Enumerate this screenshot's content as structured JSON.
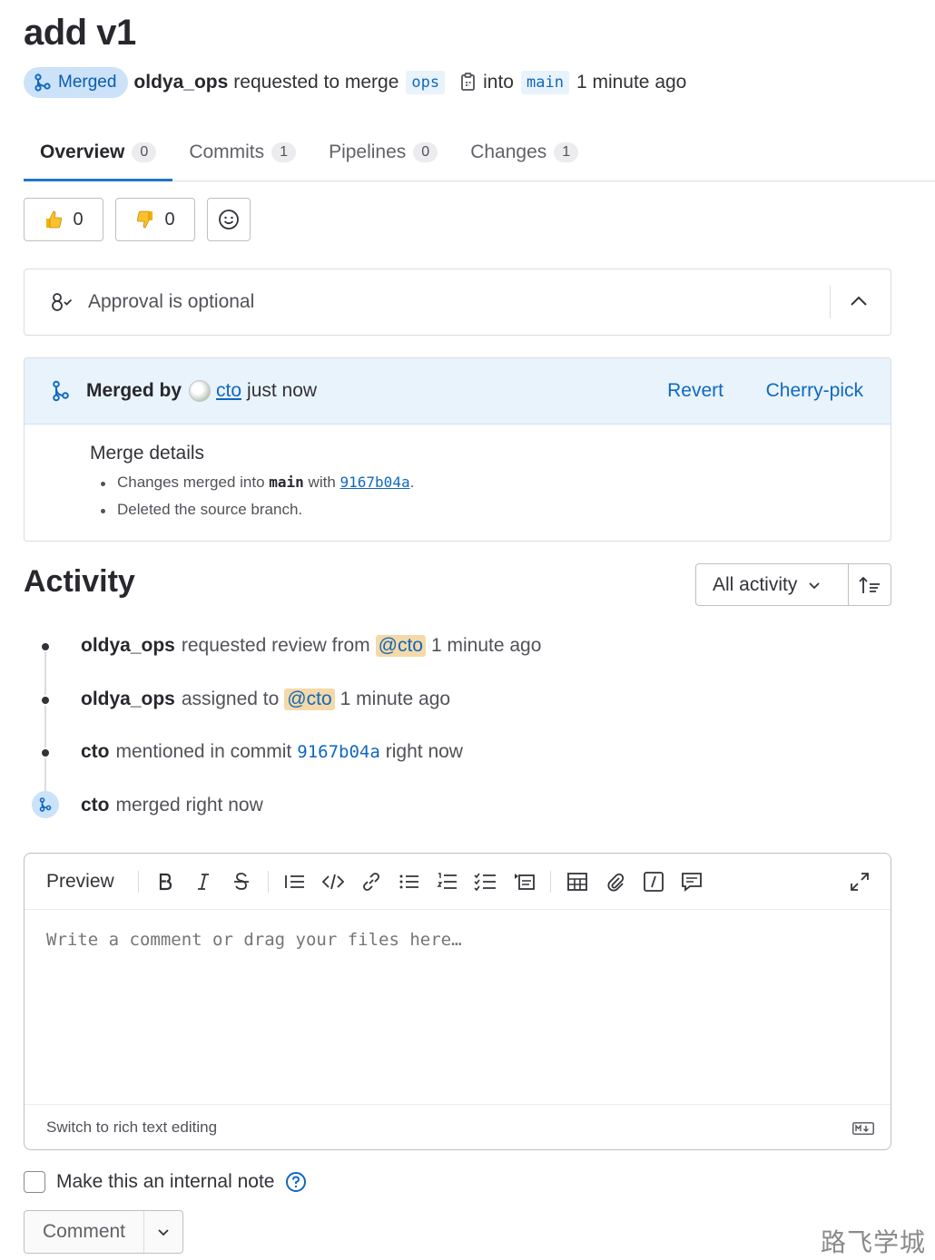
{
  "mr": {
    "title": "add v1",
    "status_badge": "Merged",
    "author": "oldya_ops",
    "requested_text": "requested to merge",
    "source_branch": "ops",
    "into_text": "into",
    "target_branch": "main",
    "time": "1 minute ago"
  },
  "tabs": [
    {
      "label": "Overview",
      "count": "0"
    },
    {
      "label": "Commits",
      "count": "1"
    },
    {
      "label": "Pipelines",
      "count": "0"
    },
    {
      "label": "Changes",
      "count": "1"
    }
  ],
  "reactions": {
    "thumbs_up": "0",
    "thumbs_down": "0"
  },
  "approval": {
    "text": "Approval is optional"
  },
  "merged": {
    "label": "Merged by",
    "user": "cto",
    "time": "just now",
    "revert": "Revert",
    "cherry_pick": "Cherry-pick",
    "details_title": "Merge details",
    "line1_prefix": "Changes merged into",
    "line1_branch": "main",
    "line1_with": "with",
    "line1_sha": "9167b04a",
    "line1_suffix": ".",
    "line2": "Deleted the source branch."
  },
  "activity": {
    "title": "Activity",
    "filter": "All activity",
    "items": [
      {
        "user": "oldya_ops",
        "text": "requested review from",
        "mention": "@cto",
        "time": "1 minute ago"
      },
      {
        "user": "oldya_ops",
        "text": "assigned to",
        "mention": "@cto",
        "time": "1 minute ago"
      },
      {
        "user": "cto",
        "text": "mentioned in commit",
        "sha": "9167b04a",
        "time": "right now"
      },
      {
        "user": "cto",
        "text": "merged right now"
      }
    ]
  },
  "editor": {
    "preview": "Preview",
    "placeholder": "Write a comment or drag your files here…",
    "switch_text": "Switch to rich text editing",
    "md_badge": "M↓"
  },
  "internal_note": {
    "label": "Make this an internal note"
  },
  "comment_button": "Comment",
  "watermark": "路飞学城",
  "colors": {
    "accent": "#1f75cb",
    "link": "#1068bf",
    "merged_bg": "#cbe2f9",
    "mention_bg": "#f5d9a8"
  }
}
